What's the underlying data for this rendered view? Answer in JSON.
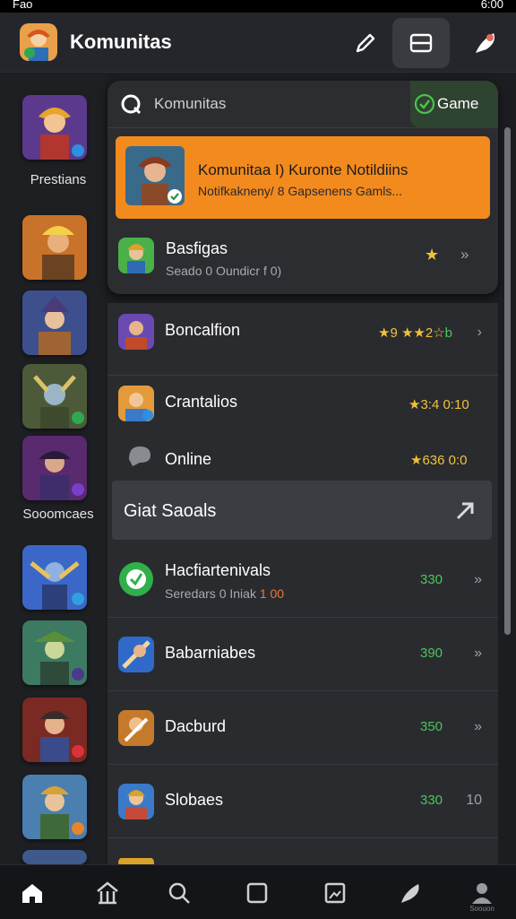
{
  "status_bar": {
    "time": "6:00",
    "left_text": "Fao"
  },
  "header": {
    "title": "Komunitas"
  },
  "sidebar": {
    "labels": [
      "Prestians",
      "Sooomcaes"
    ]
  },
  "panel": {
    "search_text": "Komunitas",
    "chip_label": "Game",
    "highlight": {
      "title": "Komunitaa I) Kuronte Notildiins",
      "subtitle": "Notifkakneny/ 8 Gapsenens Gamls..."
    },
    "item": {
      "name": "Basfigas",
      "subtitle": "Seado 0 Oundicr f 0)"
    }
  },
  "list": {
    "rows": [
      {
        "name": "Boncalfion",
        "value": "★9 ★★2☆",
        "value_tail": "b",
        "chevron": "›"
      },
      {
        "name": "Crantalios",
        "value": "★3:4 0:10",
        "chevron": ""
      },
      {
        "name": "Online",
        "value": "★636 0:0",
        "chevron": ""
      }
    ],
    "section_title": "Giat Saoals",
    "rows2": [
      {
        "name": "Hacfiartenivals",
        "sub": "Seredars 0 Iniak",
        "sub_hl": "1 00",
        "value": "330",
        "chevron": "»"
      },
      {
        "name": "Babarniabes",
        "value": "390",
        "chevron": "»"
      },
      {
        "name": "Dacburd",
        "value": "350",
        "chevron": "»"
      },
      {
        "name": "Slobaes",
        "value": "330",
        "chevron": "10"
      }
    ]
  },
  "bottom_nav": {
    "last_caption": "Soouon"
  },
  "colors": {
    "accent_orange": "#f38a1e",
    "accent_green": "#4cc55b",
    "star_yellow": "#f0c23a"
  }
}
